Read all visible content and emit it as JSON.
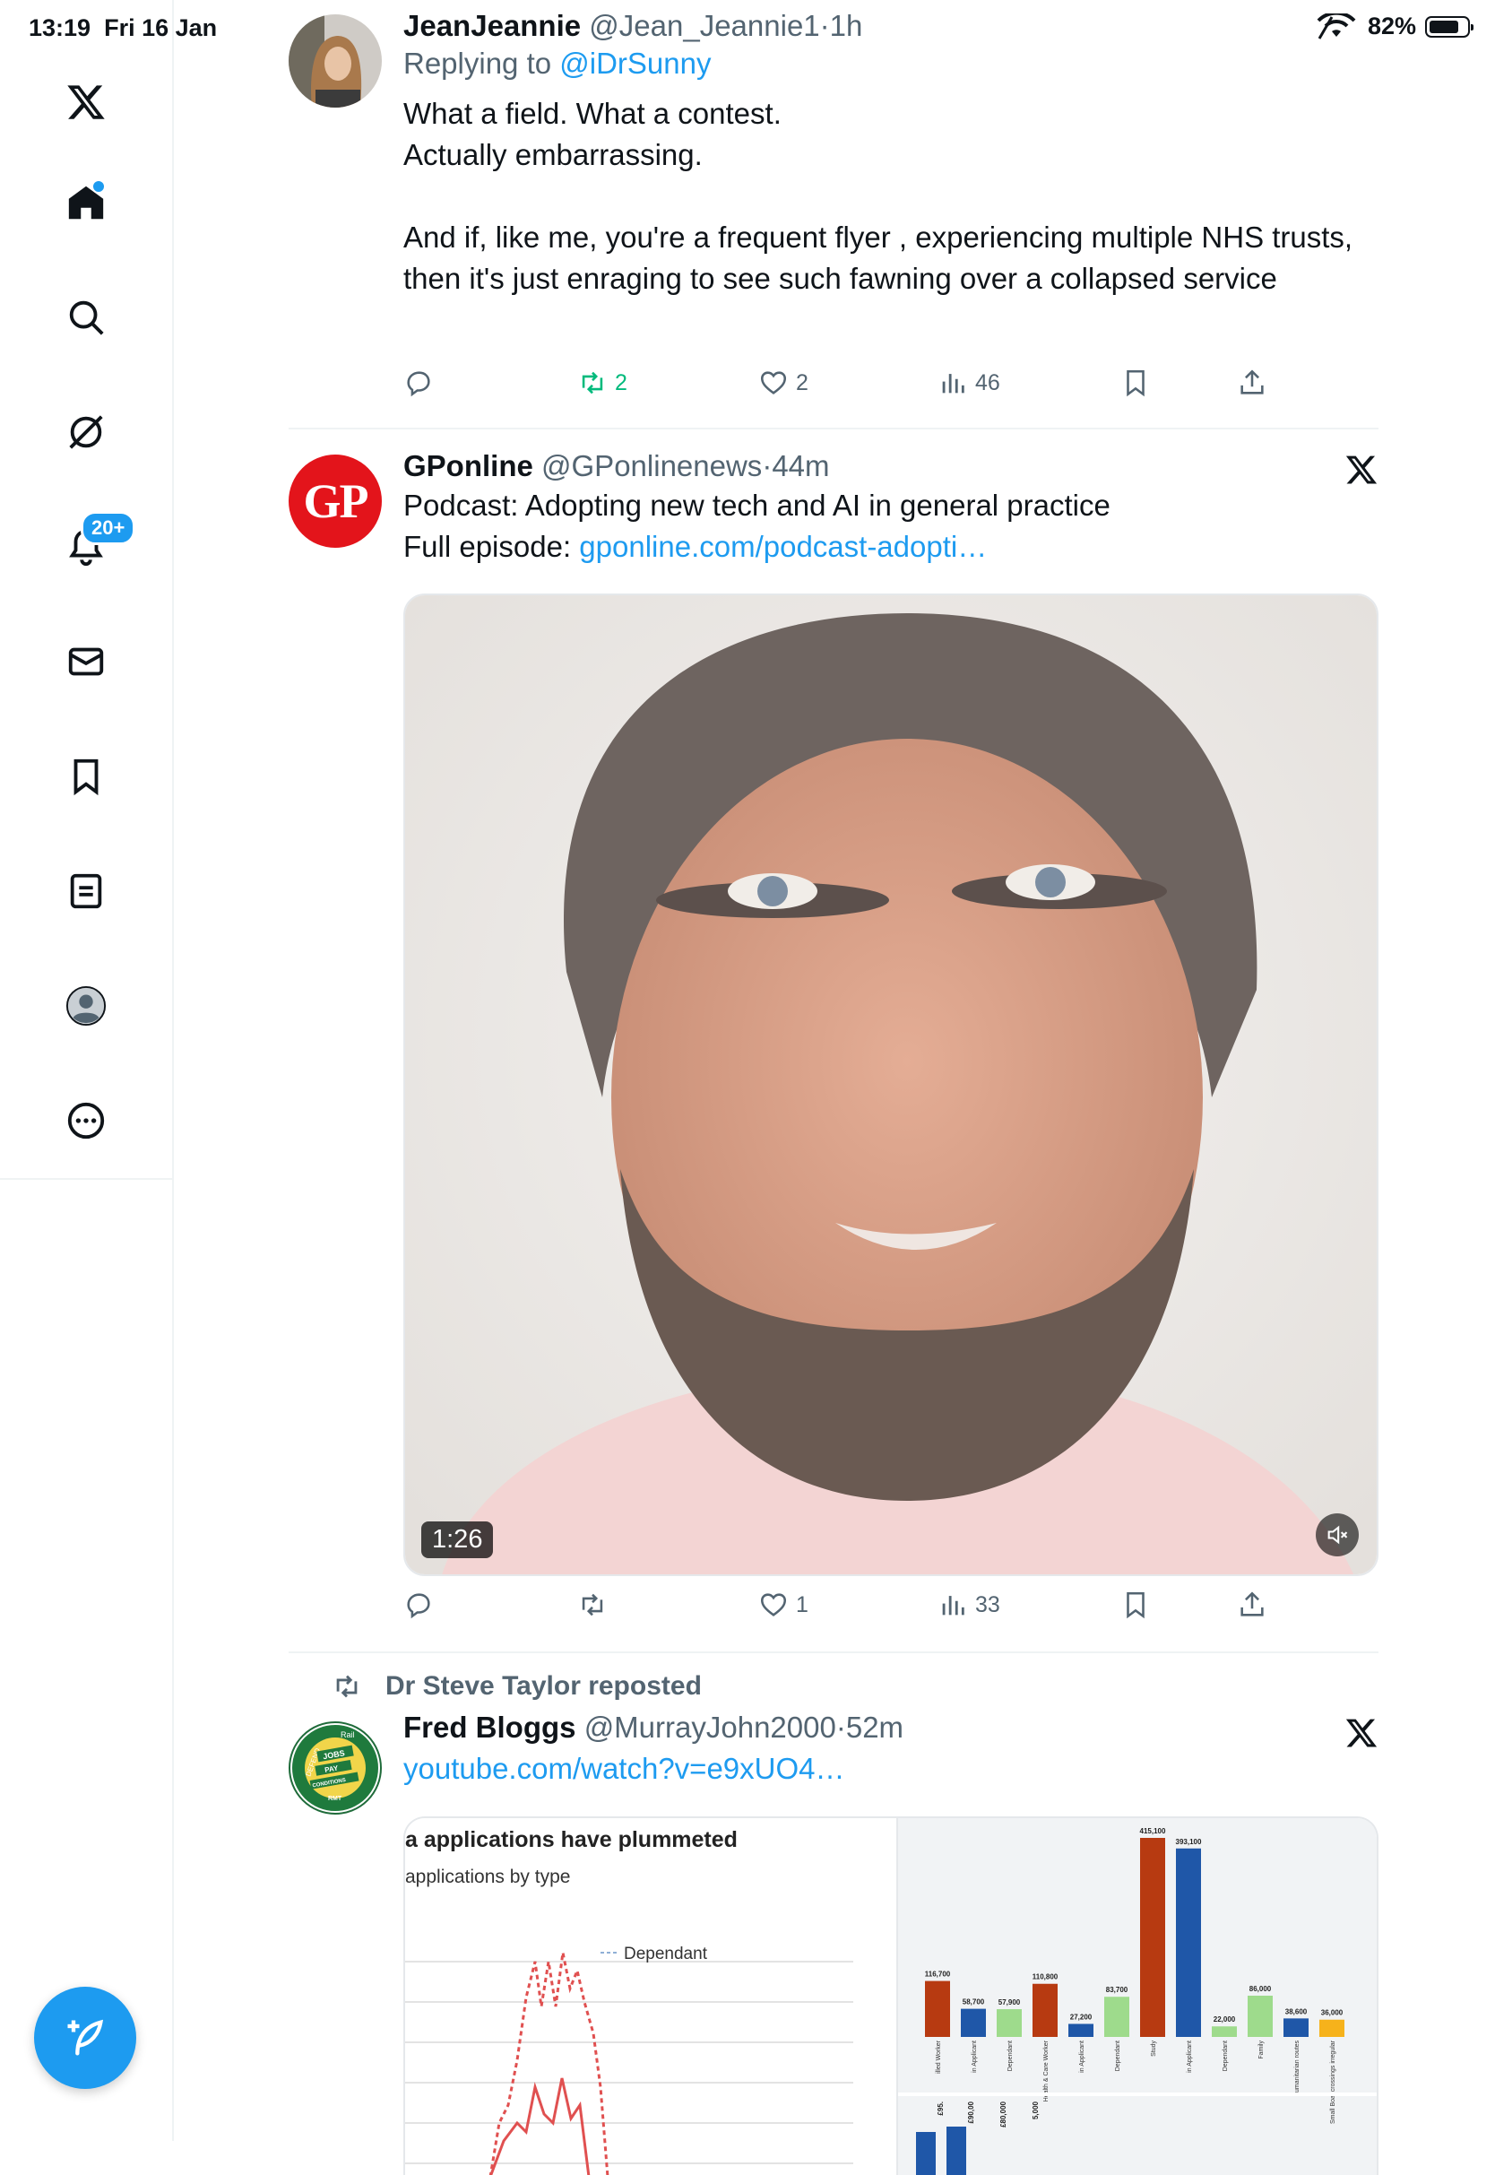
{
  "status_bar": {
    "time": "13:19",
    "date": "Fri 16 Jan",
    "battery": "82%"
  },
  "sidebar": {
    "items": [
      {
        "name": "x-logo-icon"
      },
      {
        "name": "home-icon"
      },
      {
        "name": "search-icon"
      },
      {
        "name": "grok-icon"
      },
      {
        "name": "notifications-icon",
        "badge": "20+"
      },
      {
        "name": "messages-icon"
      },
      {
        "name": "bookmarks-icon"
      },
      {
        "name": "lists-icon"
      },
      {
        "name": "profile-icon"
      },
      {
        "name": "more-icon"
      }
    ]
  },
  "tweets": [
    {
      "name": "JeanJeannie",
      "handle": "@Jean_Jeannie1",
      "time": "1h",
      "replying_prefix": "Replying to ",
      "replying_to": "@iDrSunny",
      "text": "What a field. What a contest.\nActually embarrassing.\n\nAnd if, like me, you're a frequent flyer , experiencing multiple NHS trusts, then it's just enraging to see such fawning over a collapsed service",
      "retweets": "2",
      "likes": "2",
      "views": "46"
    },
    {
      "name": "GPonline",
      "handle": "@GPonlinenews",
      "time": "44m",
      "avatar_text": "GP",
      "text": "Podcast: Adopting new tech and AI in general practice",
      "link_prefix": "Full episode: ",
      "link": "gponline.com/podcast-adopti…",
      "video_duration": "1:26",
      "retweets": "",
      "likes": "1",
      "views": "33"
    },
    {
      "repost_label": "Dr Steve Taylor reposted",
      "name": "Fred Bloggs",
      "handle": "@MurrayJohn2000",
      "time": "52m",
      "avatar_lines": [
        "DEFEND",
        "Rail",
        "JOBS",
        "PAY",
        "CONDITIONS",
        "RMT"
      ],
      "link": "youtube.com/watch?v=e9xUO4…",
      "thumb_left": {
        "title": "a applications have plummeted",
        "subtitle": "applications by type",
        "legend": "Dependant"
      },
      "thumb_right": {
        "labels": [
          "116,700",
          "58,700",
          "57,900",
          "110,800",
          "27,200",
          "83,700",
          "415,100",
          "393,100",
          "22,000",
          "86,000",
          "38,600",
          "36,000"
        ],
        "categories": [
          "illed Worker",
          "in Applicant",
          "Dependant",
          "Health & Care Worker",
          "in Applicant",
          "Dependant",
          "Study",
          "in Applicant",
          "Dependant",
          "Family",
          "umanitarian routes",
          "Small Boat crossings irregular"
        ],
        "colors": [
          "#b73a11",
          "#1f57a8",
          "#9edb8c",
          "#b73a11",
          "#1f57a8",
          "#9edb8c",
          "#b73a11",
          "#1f57a8",
          "#9edb8c",
          "#9edb8c",
          "#1f57a8",
          "#f6b21b"
        ],
        "bottom_labels": [
          "£95.",
          "£90,00",
          "£80,000",
          "5,000"
        ]
      }
    }
  ],
  "colors": {
    "accent": "#1d9bf0",
    "retweet_green": "#00ba7c",
    "gp_red": "#e3141b"
  }
}
